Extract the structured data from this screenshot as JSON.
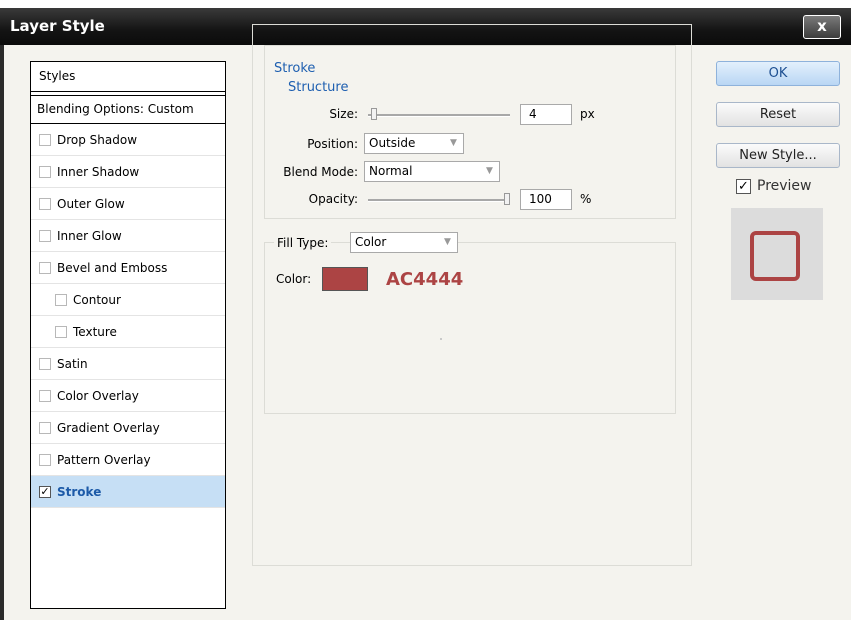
{
  "window": {
    "title": "Layer Style",
    "close_label": "x"
  },
  "styles_list": {
    "header": "Styles",
    "blending_options": "Blending Options: Custom",
    "items": [
      {
        "label": "Drop Shadow",
        "checked": false,
        "sub": false
      },
      {
        "label": "Inner Shadow",
        "checked": false,
        "sub": false
      },
      {
        "label": "Outer Glow",
        "checked": false,
        "sub": false
      },
      {
        "label": "Inner Glow",
        "checked": false,
        "sub": false
      },
      {
        "label": "Bevel and Emboss",
        "checked": false,
        "sub": false
      },
      {
        "label": "Contour",
        "checked": false,
        "sub": true
      },
      {
        "label": "Texture",
        "checked": false,
        "sub": true
      },
      {
        "label": "Satin",
        "checked": false,
        "sub": false
      },
      {
        "label": "Color Overlay",
        "checked": false,
        "sub": false
      },
      {
        "label": "Gradient Overlay",
        "checked": false,
        "sub": false
      },
      {
        "label": "Pattern Overlay",
        "checked": false,
        "sub": false
      },
      {
        "label": "Stroke",
        "checked": true,
        "sub": false,
        "active": true
      }
    ]
  },
  "stroke": {
    "group_title": "Stroke",
    "structure": {
      "title": "Structure",
      "size_label": "Size:",
      "size_value": "4",
      "size_unit": "px",
      "size_slider_fraction": 0.02,
      "position_label": "Position:",
      "position_value": "Outside",
      "blend_mode_label": "Blend Mode:",
      "blend_mode_value": "Normal",
      "opacity_label": "Opacity:",
      "opacity_value": "100",
      "opacity_unit": "%",
      "opacity_slider_fraction": 1.0
    },
    "fill": {
      "fill_type_label": "Fill Type:",
      "fill_type_value": "Color",
      "color_label": "Color:",
      "color_hex_text": "AC4444",
      "color": "#ac4444"
    }
  },
  "buttons": {
    "ok": "OK",
    "reset": "Reset",
    "new_style": "New Style...",
    "preview_label": "Preview",
    "preview_checked": true
  },
  "colors": {
    "accent": "#1e5fb0",
    "stroke_color": "#ac4444",
    "active_row": "#c6dff5"
  }
}
